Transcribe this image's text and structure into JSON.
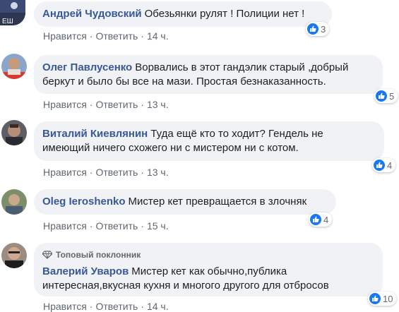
{
  "colors": {
    "author": "#385898",
    "bubble": "#f0f2f5",
    "like": "#1877f2",
    "meta": "#606770"
  },
  "comments": [
    {
      "author": "Андрей Чудовский",
      "line1": "Обезьянки рулят ! Полиции нет !",
      "line2": "",
      "like": "Нравится",
      "reply": "Ответить",
      "time": "14 ч.",
      "reactions": "3",
      "icon": "thumbs-up-icon"
    },
    {
      "author": "Олег Павлусенко",
      "line1": "Ворвались в этот гандэлик старый ,добрый",
      "line2": "беркут и было бы все на мази. Простая безнаказанность.",
      "like": "Нравится",
      "reply": "Ответить",
      "time": "13 ч.",
      "reactions": "5",
      "icon": "thumbs-up-icon"
    },
    {
      "author": "Виталий Киевлянин",
      "line1": "Туда ещё кто то ходит? Гендель не",
      "line2": "имеющий ничего схожего ни с мистером ни с котом.",
      "like": "Нравится",
      "reply": "Ответить",
      "time": "13 ч.",
      "reactions": "4",
      "icon": "thumbs-up-icon"
    },
    {
      "author": "Oleg Ieroshenko",
      "line1": "Мистер кет превращается в злочняк",
      "line2": "",
      "like": "Нравится",
      "reply": "Ответить",
      "time": "15 ч.",
      "reactions": "4",
      "icon": "thumbs-up-icon"
    },
    {
      "author": "Валерий Уваров",
      "badge": "Топовый поклонник",
      "line1": "Мистер кет как обычно,публика",
      "line2": "интересная,вкусная кухня и многого другого для отбросов",
      "like": "Нравится",
      "reply": "Ответить",
      "time": "14 ч.",
      "reactions": "10",
      "icon": "thumbs-up-icon"
    }
  ]
}
